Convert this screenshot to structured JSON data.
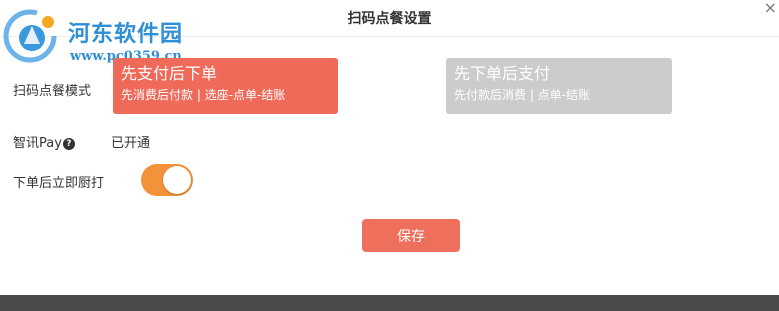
{
  "dialog": {
    "title": "扫码点餐设置",
    "close_glyph": "×"
  },
  "watermark": {
    "site_name": "河东软件园",
    "url": "www.pc0359.cn"
  },
  "order_mode": {
    "label": "扫码点餐模式",
    "options": [
      {
        "title": "先支付后下单",
        "subtitle": "先消费后付款 | 选座-点单-结账",
        "selected": true
      },
      {
        "title": "先下单后支付",
        "subtitle": "先付款后消费 | 点单-结账",
        "selected": false
      }
    ]
  },
  "zhixun_pay": {
    "label": "智讯Pay",
    "help_glyph": "?",
    "status": "已开通"
  },
  "print_after_order": {
    "label": "下单后立即厨打",
    "enabled": true
  },
  "save_label": "保存",
  "colors": {
    "accent": "#f06a5a",
    "toggle_on": "#f4923a",
    "inactive_card": "#cccccc",
    "watermark": "#2f8fd6"
  }
}
